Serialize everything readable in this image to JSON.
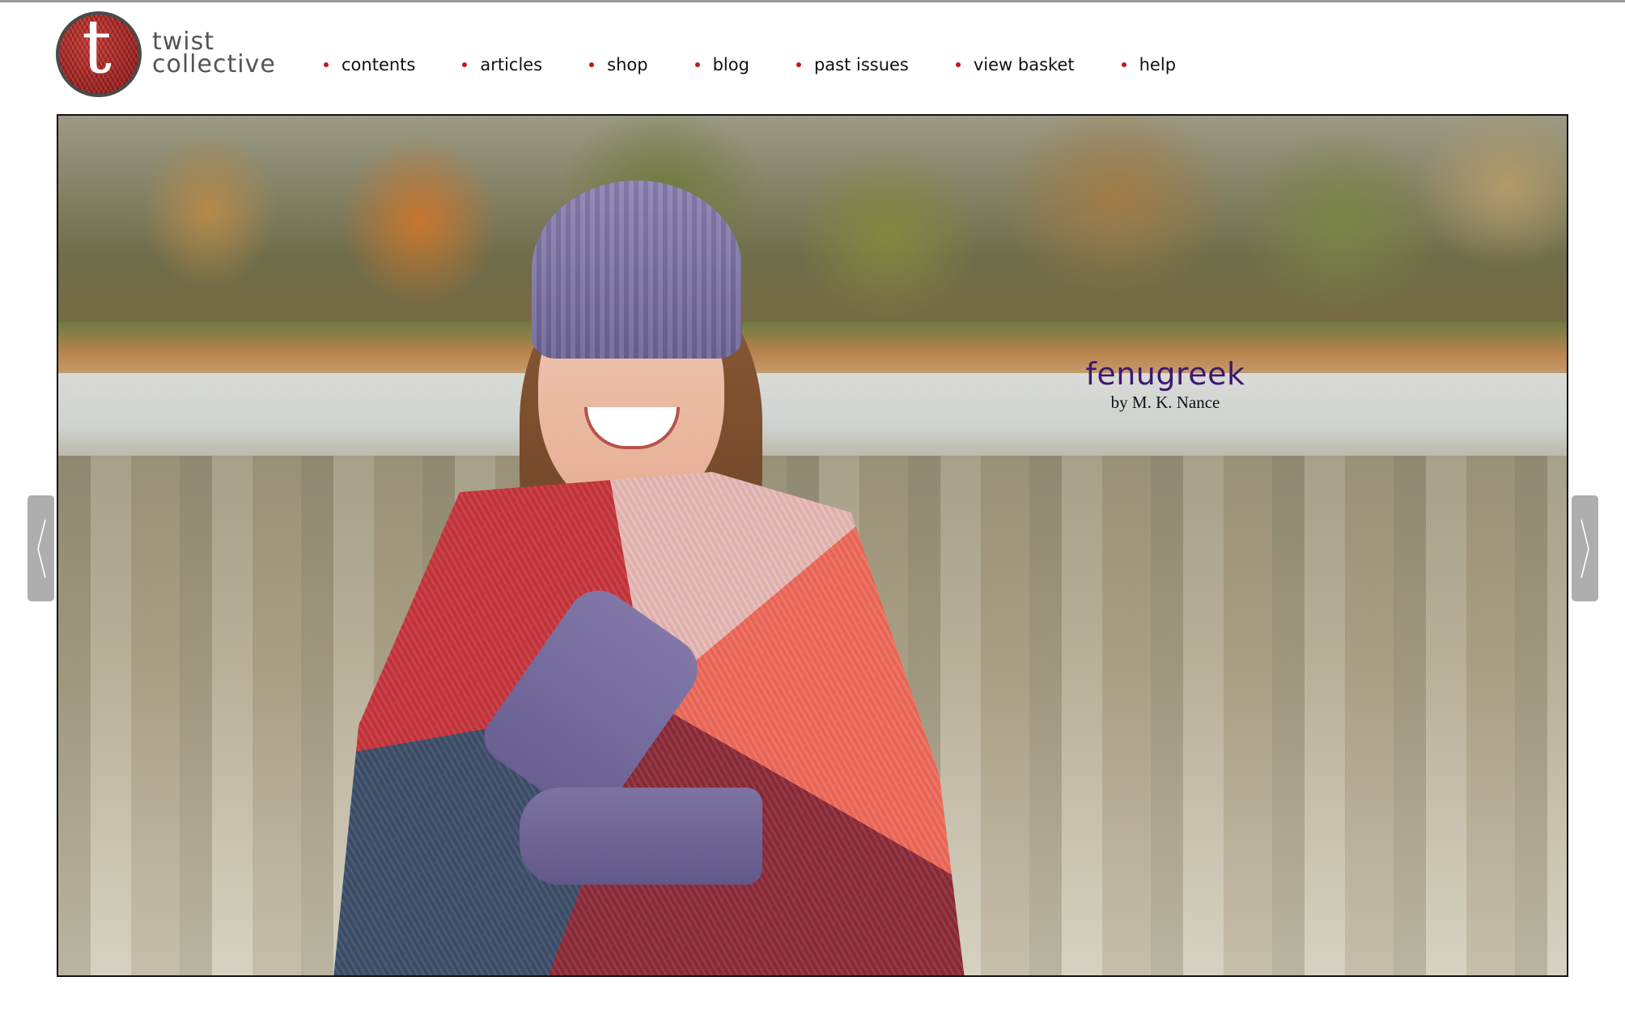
{
  "brand": {
    "logo_letter": "t",
    "name_line1": "twist",
    "name_line2": "collective",
    "accent_color": "#c01a1a"
  },
  "nav": {
    "items": [
      {
        "label": "contents"
      },
      {
        "label": "articles"
      },
      {
        "label": "shop"
      },
      {
        "label": "blog"
      },
      {
        "label": "past issues"
      },
      {
        "label": "view basket"
      },
      {
        "label": "help"
      }
    ]
  },
  "slideshow": {
    "caption_title": "fenugreek",
    "caption_byline": "by M. K. Nance",
    "caption_title_color": "#3d1970",
    "prev_icon": "chevron-left-icon",
    "next_icon": "chevron-right-icon"
  }
}
